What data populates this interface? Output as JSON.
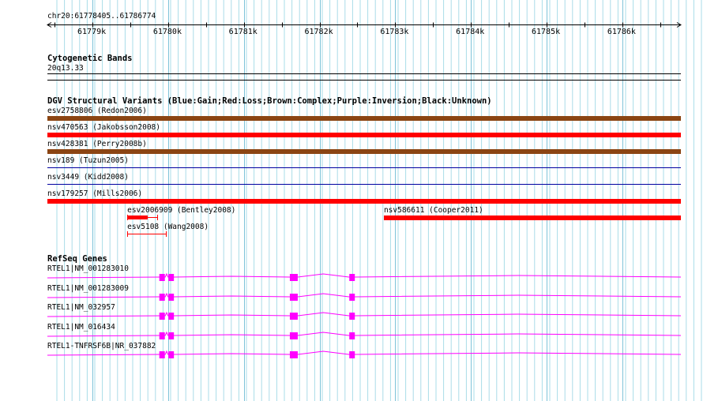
{
  "ruler": {
    "coordinates": "chr20:61778405..61786774",
    "ticks": [
      "61779k",
      "61780k",
      "61781k",
      "61782k",
      "61783k",
      "61784k",
      "61785k",
      "61786k"
    ]
  },
  "cytoband": {
    "title": "Cytogenetic Bands",
    "band": "20q13.33"
  },
  "dgv": {
    "title": "DGV Structural Variants (Blue:Gain;Red:Loss;Brown:Complex;Purple:Inversion;Black:Unknown)",
    "colors": {
      "gain": "#0000a0",
      "loss": "#ff0000",
      "complex": "#8b4513",
      "inversion": "#800080",
      "unknown": "#000000"
    },
    "variants": [
      {
        "label": "esv2758806 (Redon2006)",
        "type": "complex",
        "start": 61778405,
        "end": 61786774
      },
      {
        "label": "nsv470563 (Jakobsson2008)",
        "type": "loss",
        "start": 61778405,
        "end": 61786774
      },
      {
        "label": "nsv428381 (Perry2008b)",
        "type": "complex",
        "start": 61778405,
        "end": 61786774
      },
      {
        "label": "nsv189 (Tuzun2005)",
        "type": "gain",
        "start": 61778405,
        "end": 61786774
      },
      {
        "label": "nsv3449 (Kidd2008)",
        "type": "gain",
        "start": 61778405,
        "end": 61786774
      },
      {
        "label": "nsv179257 (Mills2006)",
        "type": "loss",
        "start": 61778405,
        "end": 61786774
      },
      {
        "label": "esv2006909 (Bentley2008)",
        "type": "loss",
        "start": 61779460,
        "end": 61779860,
        "solid_end": 61779730
      },
      {
        "label": "nsv586611 (Cooper2011)",
        "type": "loss",
        "start": 61782850,
        "end": 61786774
      },
      {
        "label": "esv5108 (Wang2008)",
        "type": "loss",
        "start": 61779460,
        "end": 61779970
      }
    ]
  },
  "refseq": {
    "title": "RefSeq Genes",
    "color": "#ff00ff",
    "exons": [
      61779920,
      61780040,
      61781660,
      61782430
    ],
    "genes": [
      {
        "label": "RTEL1|NM_001283010"
      },
      {
        "label": "RTEL1|NM_001283009"
      },
      {
        "label": "RTEL1|NM_032957"
      },
      {
        "label": "RTEL1|NM_016434"
      },
      {
        "label": "RTEL1-TNFRSF6B|NR_037882"
      }
    ]
  }
}
